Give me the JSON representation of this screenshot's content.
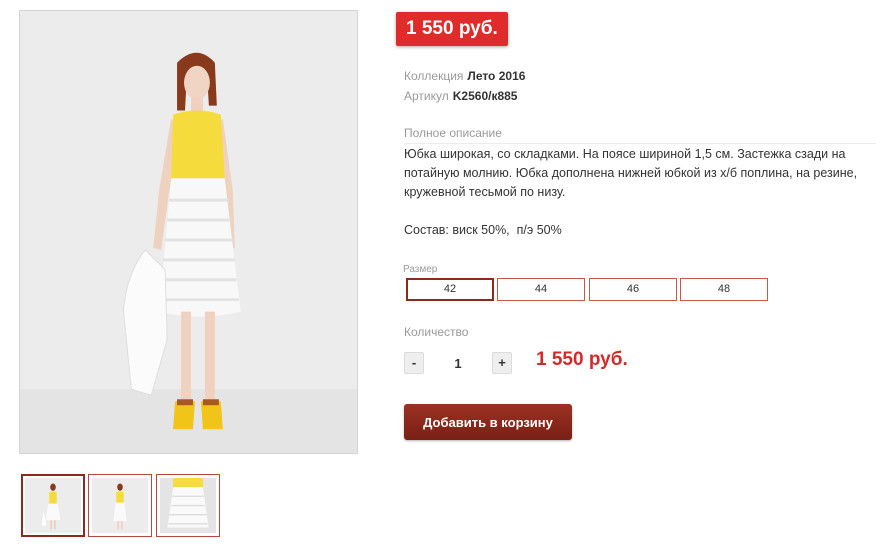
{
  "product": {
    "price_badge": "1 550 руб.",
    "collection_label": "Коллекция",
    "collection_value": "Лето 2016",
    "article_label": "Артикул",
    "article_value": "K2560/к885",
    "description_label": "Полное описание",
    "description_text": "Юбка широкая, со складками. На поясе шириной 1,5 см. Застежка сзади на потайную молнию. Юбка дополнена нижней юбкой из х/б поплина, на резине, кружевной тесьмой по низу.",
    "composition_text": "Состав: виск 50%,  п/э 50%"
  },
  "sizes": {
    "label": "Размер",
    "options": [
      "42",
      "44",
      "46",
      "48"
    ],
    "selected": "42"
  },
  "quantity": {
    "label": "Количество",
    "minus": "-",
    "value": "1",
    "plus": "+",
    "total": "1 550 руб."
  },
  "cart": {
    "button_label": "Добавить в корзину"
  },
  "colors": {
    "badge": "#e02b2b",
    "accent": "#8b2a1d",
    "total": "#d62a2a"
  }
}
